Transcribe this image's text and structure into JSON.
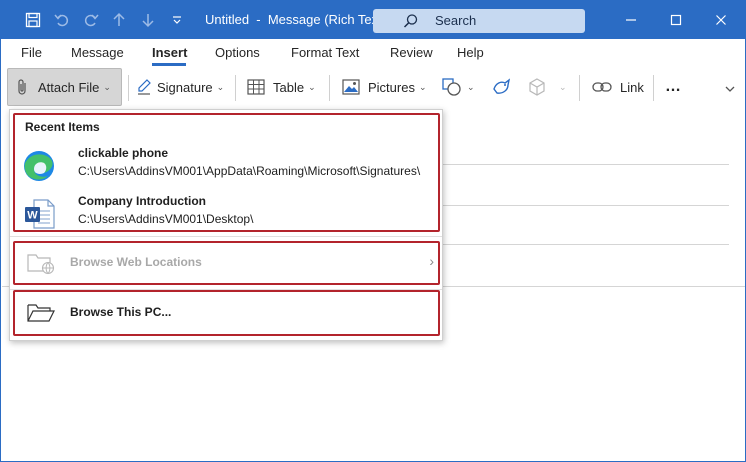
{
  "window": {
    "title": "Untitled  -  Message (Rich Text)",
    "search_placeholder": "Search"
  },
  "tabs": [
    {
      "label": "File"
    },
    {
      "label": "Message"
    },
    {
      "label": "Insert",
      "active": true
    },
    {
      "label": "Options"
    },
    {
      "label": "Format Text"
    },
    {
      "label": "Review"
    },
    {
      "label": "Help"
    }
  ],
  "ribbon": {
    "attach_file": "Attach File",
    "signature": "Signature",
    "table": "Table",
    "pictures": "Pictures",
    "link": "Link",
    "more": "…"
  },
  "dropdown": {
    "recent_title": "Recent Items",
    "recent_items": [
      {
        "name": "clickable phone",
        "path": "C:\\Users\\AddinsVM001\\AppData\\Roaming\\Microsoft\\Signatures\\",
        "icon": "edge-icon"
      },
      {
        "name": "Company Introduction",
        "path": "C:\\Users\\AddinsVM001\\Desktop\\",
        "icon": "word-doc-icon"
      }
    ],
    "browse_web": "Browse Web Locations",
    "browse_pc": "Browse This PC..."
  },
  "colors": {
    "accent": "#2b6cc4",
    "highlight_border": "#b3242c",
    "edge_blue": "#1e88e5",
    "edge_green": "#43c06b",
    "word_blue": "#2b579a"
  }
}
